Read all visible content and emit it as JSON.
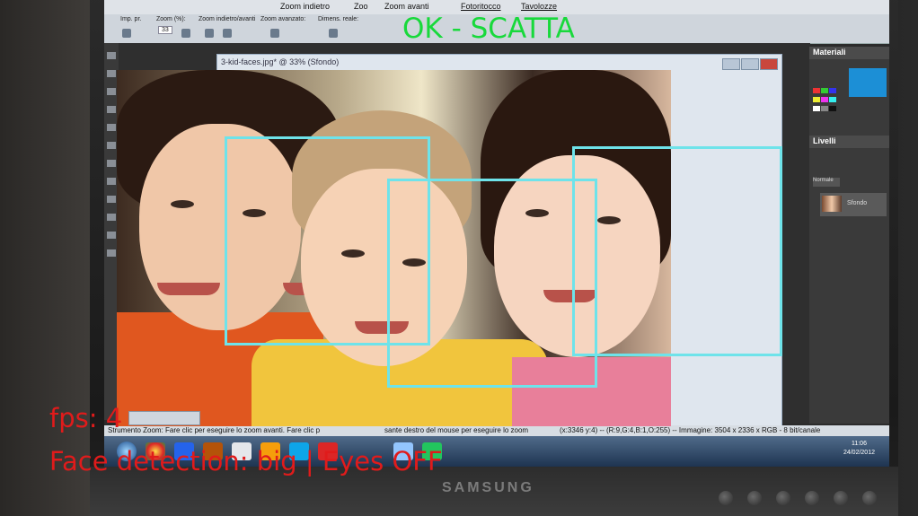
{
  "overlay": {
    "capture_status": "OK - SCATTA",
    "fps_text": "fps: 4",
    "detection_text": "Face detection: big | Eyes OFF",
    "status_color": "#18d93b",
    "info_color": "#e01b1b",
    "box_color": "#6ee3ea",
    "detected_faces": 3
  },
  "monitor": {
    "brand": "SAMSUNG"
  },
  "app": {
    "menu": {
      "zoom_out": "Zoom indietro",
      "zoom_in_partial": "Zoo",
      "zoom_in_2": "Zoom avanti",
      "photo_retouch": "Fotoritocco",
      "boards": "Tavolozze"
    },
    "toolbar": {
      "preset": "Imp. pr.",
      "zoom_pct": "Zoom (%):",
      "zoom_value": "33",
      "zoom_in_out": "Zoom indietro/avanti",
      "advanced_zoom": "Zoom avanzato:",
      "real_size": "Dimens. reale:"
    },
    "doc_title": "3-kid-faces.jpg* @ 33% (Sfondo)",
    "panels": {
      "materials": "Materiali",
      "layers": "Livelli",
      "layer_name": "Sfondo",
      "blend_mode": "Normale"
    },
    "status_left": "Strumento Zoom: Fare clic per eseguire lo zoom avanti. Fare clic p",
    "status_right": "sante destro del mouse per eseguire lo zoom",
    "coords": "(x:3346 y:4) -- (R:9,G:4,B:1,O:255) -- Immagine: 3504 x 2336 x RGB - 8 bit/canale",
    "clock_time": "11:06",
    "clock_date": "24/02/2012"
  }
}
